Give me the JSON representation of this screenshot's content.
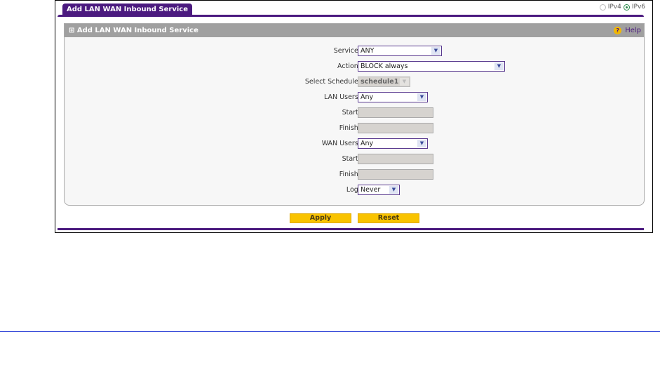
{
  "tab_title": "Add LAN WAN Inbound Service",
  "ip_versions": [
    {
      "label": "IPv4",
      "selected": false
    },
    {
      "label": "IPv6",
      "selected": true
    }
  ],
  "panel": {
    "title": "Add LAN WAN Inbound Service",
    "help": "Help"
  },
  "fields": {
    "service": {
      "label": "Service:",
      "value": "ANY"
    },
    "action": {
      "label": "Action:",
      "value": "BLOCK always"
    },
    "schedule": {
      "label": "Select Schedule:",
      "value": "schedule1"
    },
    "lan_users": {
      "label": "LAN Users:",
      "value": "Any"
    },
    "lan_start": {
      "label": "Start:",
      "value": ""
    },
    "lan_finish": {
      "label": "Finish:",
      "value": ""
    },
    "wan_users": {
      "label": "WAN Users:",
      "value": "Any"
    },
    "wan_start": {
      "label": "Start:",
      "value": ""
    },
    "wan_finish": {
      "label": "Finish:",
      "value": ""
    },
    "log": {
      "label": "Log:",
      "value": "Never"
    }
  },
  "buttons": {
    "apply": "Apply",
    "reset": "Reset"
  }
}
